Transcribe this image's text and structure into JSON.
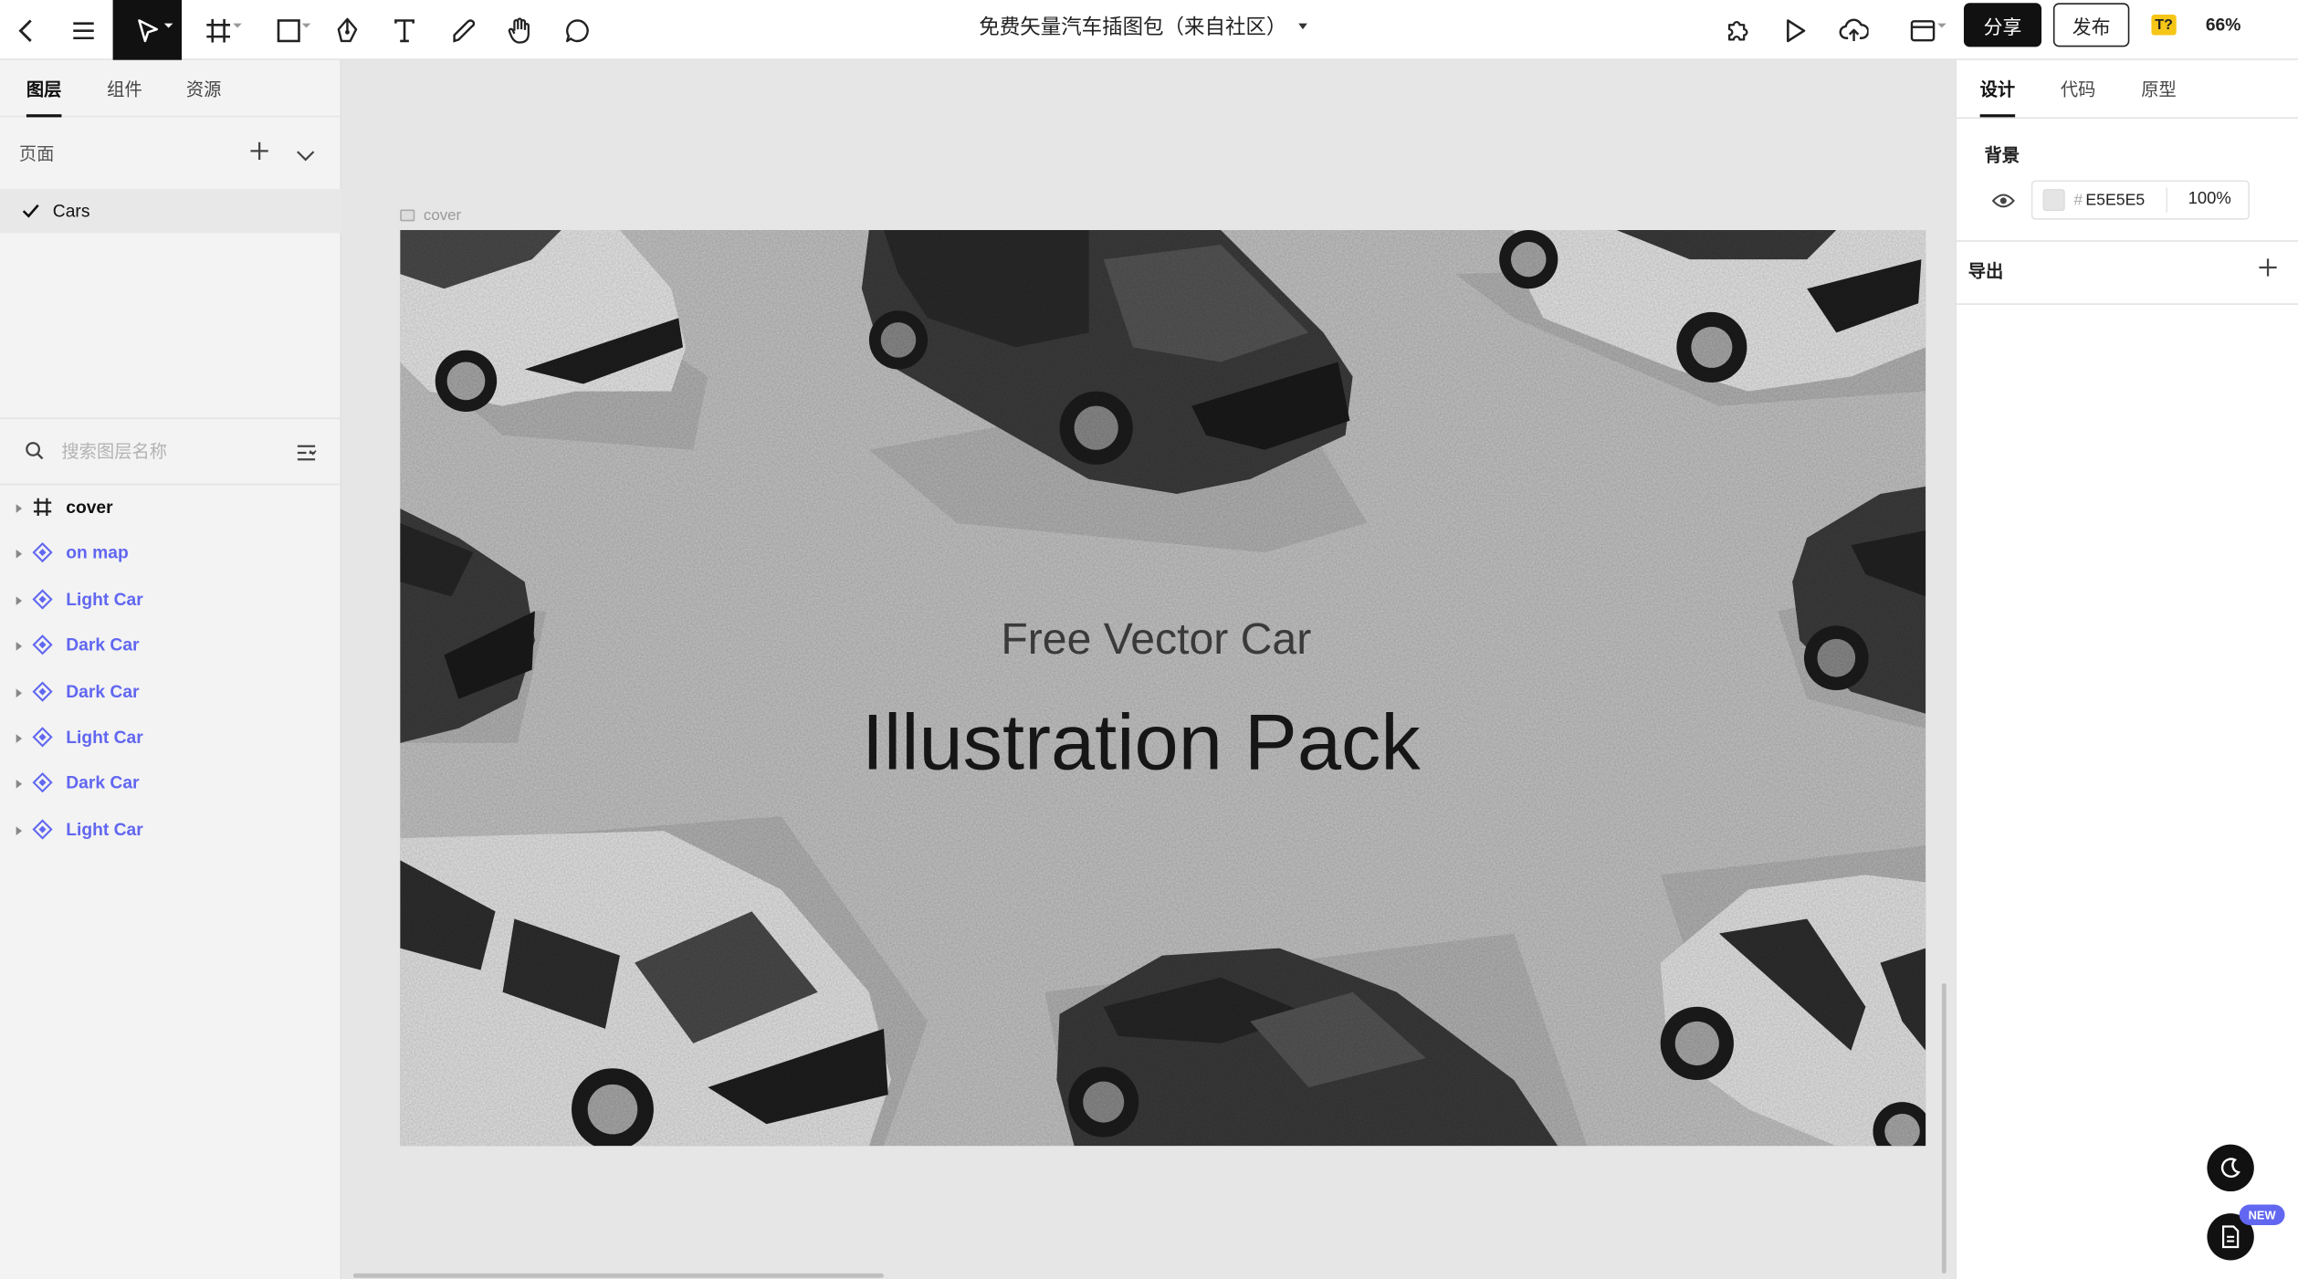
{
  "toolbar": {
    "doc_title": "免费矢量汽车插图包（来自社区）",
    "share_label": "分享",
    "publish_label": "发布",
    "zoom": "66%",
    "plugin_badge": "T?"
  },
  "left_panel": {
    "tabs": [
      {
        "label": "图层"
      },
      {
        "label": "组件"
      },
      {
        "label": "资源"
      }
    ],
    "active_tab": "图层",
    "pages_header": "页面",
    "current_page": "Cars",
    "search_placeholder": "搜索图层名称",
    "layers": [
      {
        "name": "cover",
        "type": "frame"
      },
      {
        "name": "on map",
        "type": "component"
      },
      {
        "name": "Light Car",
        "type": "component"
      },
      {
        "name": "Dark Car",
        "type": "component"
      },
      {
        "name": "Dark Car",
        "type": "component"
      },
      {
        "name": "Light Car",
        "type": "component"
      },
      {
        "name": "Dark Car",
        "type": "component"
      },
      {
        "name": "Light Car",
        "type": "component"
      }
    ]
  },
  "canvas": {
    "frame_label": "cover",
    "headline_small": "Free Vector Car",
    "headline_large": "Illustration Pack",
    "background_color": "#C4C4C4"
  },
  "right_panel": {
    "tabs": [
      {
        "label": "设计"
      },
      {
        "label": "代码"
      },
      {
        "label": "原型"
      }
    ],
    "active_tab": "设计",
    "background_title": "背景",
    "background_hash": "#",
    "background_hex": "E5E5E5",
    "background_opacity": "100%",
    "export_title": "导出"
  },
  "floating": {
    "new_badge": "NEW"
  },
  "colors": {
    "accent": "#6167F0",
    "dark": "#111111",
    "badge_yellow": "#F5C518"
  }
}
